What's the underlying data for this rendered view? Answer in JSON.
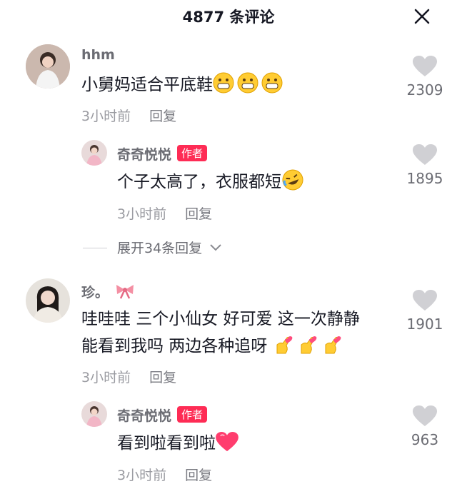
{
  "header": {
    "title": "4877 条评论"
  },
  "comments": [
    {
      "name": "hhm",
      "text": "小舅妈适合平底鞋",
      "time": "3小时前",
      "reply": "回复",
      "likes": "2309",
      "emoji": "grinning-face",
      "reply_item": {
        "name": "奇奇悦悦",
        "author_tag": "作者",
        "text": "个子太高了，衣服都短",
        "time": "3小时前",
        "reply": "回复",
        "likes": "1895",
        "emoji": "rolling-laughing-face"
      },
      "expand": "展开34条回复"
    },
    {
      "name": "珍。",
      "text_line1": "哇哇哇 三个小仙女 好可爱 这一次静静",
      "text_line2": "能看到我吗 两边各种追呀",
      "time": "3小时前",
      "reply": "回复",
      "likes": "1901",
      "emoji": "finger-heart",
      "reply_item": {
        "name": "奇奇悦悦",
        "author_tag": "作者",
        "text": "看到啦看到啦",
        "time": "3小时前",
        "reply": "回复",
        "likes": "963",
        "emoji": "pink-heart"
      }
    }
  ],
  "colors": {
    "accent": "#fe2c55",
    "text": "#161823",
    "muted": "#9a9ba1"
  }
}
